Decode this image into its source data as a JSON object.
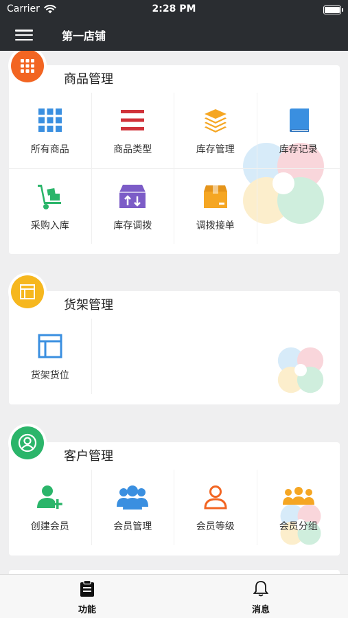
{
  "status_bar": {
    "carrier": "Carrier",
    "time": "2:28 PM"
  },
  "nav": {
    "title": "第一店铺"
  },
  "sections": [
    {
      "title": "商品管理",
      "badge_color": "#f26522",
      "items": [
        {
          "label": "所有商品",
          "icon": "grid-icon",
          "color": "#3a8fe0"
        },
        {
          "label": "商品类型",
          "icon": "list-bars-icon",
          "color": "#d0323a"
        },
        {
          "label": "库存管理",
          "icon": "layers-icon",
          "color": "#f5a623"
        },
        {
          "label": "库存记录",
          "icon": "book-icon",
          "color": "#3a8fe0"
        },
        {
          "label": "采购入库",
          "icon": "hand-truck-icon",
          "color": "#2bb56a"
        },
        {
          "label": "库存调拨",
          "icon": "transfer-box-icon",
          "color": "#7c5cc7"
        },
        {
          "label": "调拨接单",
          "icon": "package-icon",
          "color": "#f5a623"
        }
      ]
    },
    {
      "title": "货架管理",
      "badge_color": "#f6b71e",
      "items": [
        {
          "label": "货架货位",
          "icon": "shelf-layout-icon",
          "color": "#3a8fe0"
        }
      ]
    },
    {
      "title": "客户管理",
      "badge_color": "#2bb56a",
      "items": [
        {
          "label": "创建会员",
          "icon": "add-user-icon",
          "color": "#2bb56a"
        },
        {
          "label": "会员管理",
          "icon": "users-group-icon",
          "color": "#3a8fe0"
        },
        {
          "label": "会员等级",
          "icon": "user-outline-icon",
          "color": "#f26522"
        },
        {
          "label": "会员分组",
          "icon": "team-icon",
          "color": "#f5a623"
        }
      ]
    }
  ],
  "tabbar": {
    "items": [
      {
        "label": "功能",
        "icon": "clipboard-icon"
      },
      {
        "label": "消息",
        "icon": "bell-icon"
      }
    ]
  }
}
